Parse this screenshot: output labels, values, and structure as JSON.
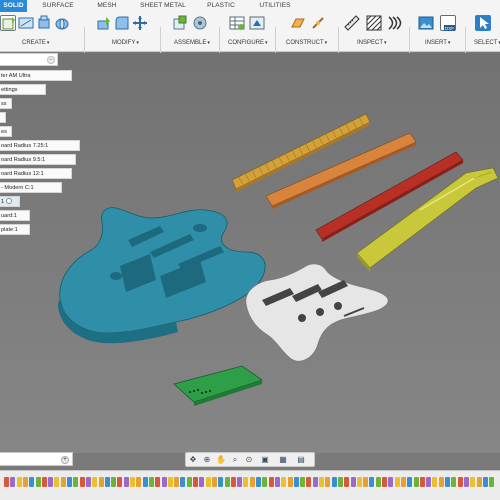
{
  "toolbar": {
    "tabs": [
      {
        "label": "SOLID",
        "active": true
      },
      {
        "label": "SURFACE",
        "active": false
      },
      {
        "label": "MESH",
        "active": false
      },
      {
        "label": "SHEET METAL",
        "active": false
      },
      {
        "label": "PLASTIC",
        "active": false
      },
      {
        "label": "UTILITIES",
        "active": false
      }
    ],
    "groups": [
      {
        "label": "CREATE",
        "icons": [
          "new-component-icon",
          "create-sketch-icon",
          "extrude-icon",
          "revolve-icon"
        ]
      },
      {
        "label": "MODIFY",
        "icons": [
          "press-pull-icon",
          "fillet-icon",
          "move-icon"
        ]
      },
      {
        "label": "ASSEMBLE",
        "icons": [
          "new-component-icon",
          "joint-icon"
        ]
      },
      {
        "label": "CONFIGURE",
        "icons": [
          "configure-table-icon",
          "configure-theme-icon"
        ]
      },
      {
        "label": "CONSTRUCT",
        "icons": [
          "offset-plane-icon",
          "axis-icon"
        ]
      },
      {
        "label": "INSPECT",
        "icons": [
          "measure-icon",
          "section-analysis-icon",
          "zebra-icon"
        ]
      },
      {
        "label": "INSERT",
        "icons": [
          "insert-image-icon",
          "insert-dxf-icon"
        ]
      },
      {
        "label": "SELECT",
        "icons": [
          "select-icon"
        ]
      }
    ],
    "insert_icon_text": "DXF"
  },
  "browser": {
    "items": [
      {
        "label": "ter AM Ultra"
      },
      {
        "label": "ettings"
      },
      {
        "label": "ss"
      },
      {
        "label": ""
      },
      {
        "label": "es"
      },
      {
        "label": "oard Radius 7.25:1"
      },
      {
        "label": "oard Radius 9.5:1"
      },
      {
        "label": "oard Radius 12:1"
      },
      {
        "label": "- Modern C:1"
      },
      {
        "label": "1"
      },
      {
        "label": "uard:1"
      },
      {
        "label": "plate:1"
      }
    ]
  },
  "viewport": {
    "colors": {
      "body": "#2f8fa8",
      "pickguard": "#e6e6e6",
      "neck": "#c8c83a",
      "fretboard_maple": "#d4a038",
      "fretboard_orange": "#d8843c",
      "fretboard_red": "#b83024",
      "plate": "#2e9e48"
    }
  },
  "navbar": {
    "buttons": [
      "orbit-icon",
      "pan-icon",
      "look-at-icon",
      "zoom-icon",
      "fit-icon",
      "display-settings-icon",
      "grid-settings-icon",
      "viewports-icon"
    ]
  },
  "timeline": {
    "controls": [
      "go-to-start",
      "step-back",
      "play",
      "step-forward",
      "go-to-end"
    ]
  }
}
